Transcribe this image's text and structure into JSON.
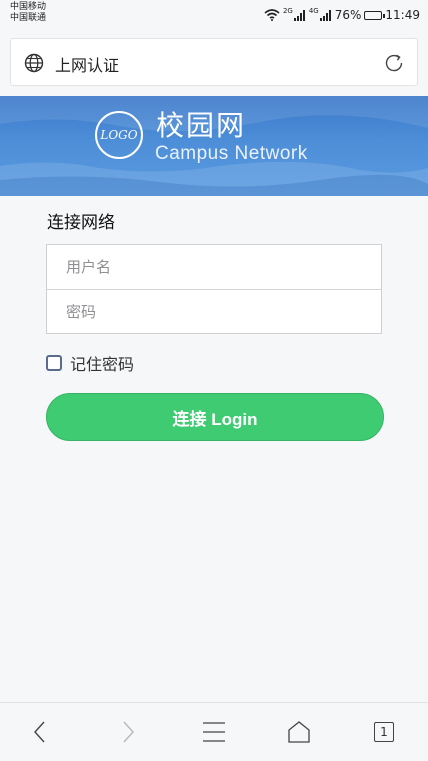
{
  "status_bar": {
    "carrier_1": "中国移动",
    "carrier_2": "中国联通",
    "signal_1_label": "2G",
    "signal_2_label": "4G",
    "battery": "76%",
    "battery_level": 0.76,
    "time": "11:49"
  },
  "address_bar": {
    "title": "上网认证",
    "left_icon": "globe-icon",
    "right_icon": "refresh-icon"
  },
  "banner": {
    "logo_text": "LOGO",
    "title": "校园网",
    "subtitle": "Campus  Network",
    "color": "#4a87d5"
  },
  "form": {
    "title": "连接网络",
    "username_placeholder": "用户名",
    "username_value": "",
    "password_placeholder": "密码",
    "password_value": "",
    "remember_label": "记住密码",
    "remember_checked": false,
    "login_label": "连接 Login",
    "login_color": "#3fcb72"
  },
  "bottom_nav": {
    "back_icon": "chevron-left-icon",
    "forward_icon": "chevron-right-icon",
    "menu_icon": "menu-icon",
    "home_icon": "home-icon",
    "tabs_count": "1"
  }
}
